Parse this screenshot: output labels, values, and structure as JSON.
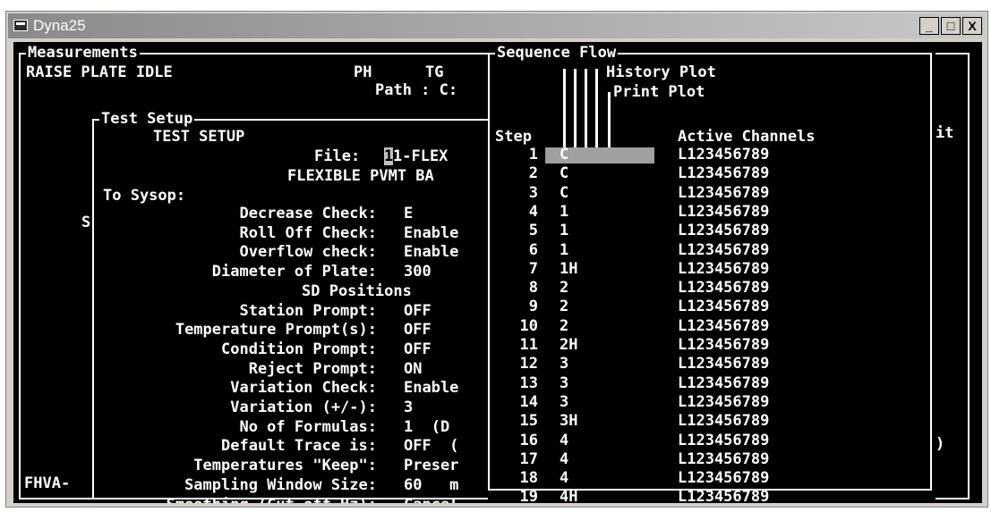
{
  "window": {
    "title": "Dyna25",
    "min_label": "_",
    "max_label": "□",
    "close_label": "X"
  },
  "measurements": {
    "caption": "Measurements",
    "line1_left": "RAISE PLATE IDLE",
    "line1_ph": "PH",
    "line1_tg": "TG",
    "path_label": "Path : C:",
    "right_fragment": "it",
    "left_s": "S",
    "right_paren": ")",
    "bottom_left": "FHVA-"
  },
  "test_setup": {
    "caption": "Test Setup",
    "heading": "TEST SETUP",
    "file_label": "File:",
    "file_value_hl": "1",
    "file_value": "1-FLEX",
    "subtitle": "FLEXIBLE PVMT BA",
    "to_sysop": "To Sysop:",
    "rows": [
      {
        "label": "Decrease Check:",
        "value": "E"
      },
      {
        "label": "Roll Off Check:",
        "value": "Enable"
      },
      {
        "label": "Overflow check:",
        "value": "Enable"
      },
      {
        "label": "Diameter of Plate:",
        "value": "300"
      },
      {
        "label": "",
        "value": "SD Positions"
      },
      {
        "label": "Station Prompt:",
        "value": "OFF"
      },
      {
        "label": "Temperature Prompt(s):",
        "value": "OFF"
      },
      {
        "label": "Condition Prompt:",
        "value": "OFF"
      },
      {
        "label": "Reject Prompt:",
        "value": "ON"
      },
      {
        "label": "Variation Check:",
        "value": "Enable"
      },
      {
        "label": "Variation (+/-):",
        "value": "3"
      },
      {
        "label": "No of Formulas:",
        "value": "1  (D"
      },
      {
        "label": "Default Trace is:",
        "value": "OFF  ("
      },
      {
        "label": "Temperatures \"Keep\":",
        "value": "Preser"
      },
      {
        "label": "Sampling Window Size:",
        "value": "60   m"
      },
      {
        "label": "Smoothing (Cut off Hz):",
        "value": "Cancel"
      }
    ]
  },
  "sequence_flow": {
    "caption": "Sequence Flow",
    "history_plot": "History Plot",
    "print_plot": "Print Plot",
    "col_step": "Step",
    "col_channels": "Active Channels",
    "rows": [
      {
        "step": "1",
        "flow": "C",
        "channels": "L123456789"
      },
      {
        "step": "2",
        "flow": "C",
        "channels": "L123456789"
      },
      {
        "step": "3",
        "flow": "C",
        "channels": "L123456789"
      },
      {
        "step": "4",
        "flow": "1",
        "channels": "L123456789"
      },
      {
        "step": "5",
        "flow": "1",
        "channels": "L123456789"
      },
      {
        "step": "6",
        "flow": "1",
        "channels": "L123456789"
      },
      {
        "step": "7",
        "flow": "1H",
        "channels": "L123456789"
      },
      {
        "step": "8",
        "flow": "2",
        "channels": "L123456789"
      },
      {
        "step": "9",
        "flow": "2",
        "channels": "L123456789"
      },
      {
        "step": "10",
        "flow": "2",
        "channels": "L123456789"
      },
      {
        "step": "11",
        "flow": "2H",
        "channels": "L123456789"
      },
      {
        "step": "12",
        "flow": "3",
        "channels": "L123456789"
      },
      {
        "step": "13",
        "flow": "3",
        "channels": "L123456789"
      },
      {
        "step": "14",
        "flow": "3",
        "channels": "L123456789"
      },
      {
        "step": "15",
        "flow": "3H",
        "channels": "L123456789"
      },
      {
        "step": "16",
        "flow": "4",
        "channels": "L123456789"
      },
      {
        "step": "17",
        "flow": "4",
        "channels": "L123456789"
      },
      {
        "step": "18",
        "flow": "4",
        "channels": "L123456789"
      },
      {
        "step": "19",
        "flow": "4H",
        "channels": "L123456789"
      }
    ]
  }
}
